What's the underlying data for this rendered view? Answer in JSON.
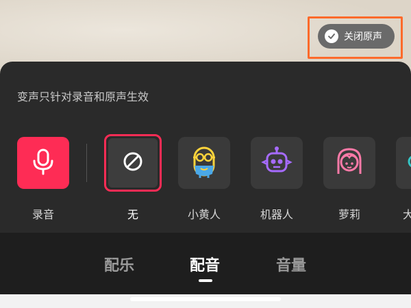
{
  "header": {
    "close_original_label": "关闭原声",
    "close_original_icon": "check-circle-icon"
  },
  "panel": {
    "hint": "变声只针对录音和原声生效",
    "effects": [
      {
        "label": "录音",
        "icon": "microphone-icon"
      },
      {
        "label": "无",
        "icon": "no-effect-icon",
        "selected": true
      },
      {
        "label": "小黄人",
        "icon": "minion-icon"
      },
      {
        "label": "机器人",
        "icon": "robot-icon"
      },
      {
        "label": "萝莉",
        "icon": "girl-icon"
      },
      {
        "label": "大",
        "icon": "more-effect-icon"
      }
    ]
  },
  "tabs": [
    {
      "label": "配乐"
    },
    {
      "label": "配音",
      "active": true
    },
    {
      "label": "音量"
    }
  ],
  "colors": {
    "accent": "#fe2c55",
    "highlight_outline": "#ff6a2b",
    "panel_bg": "#2a2a2a"
  }
}
